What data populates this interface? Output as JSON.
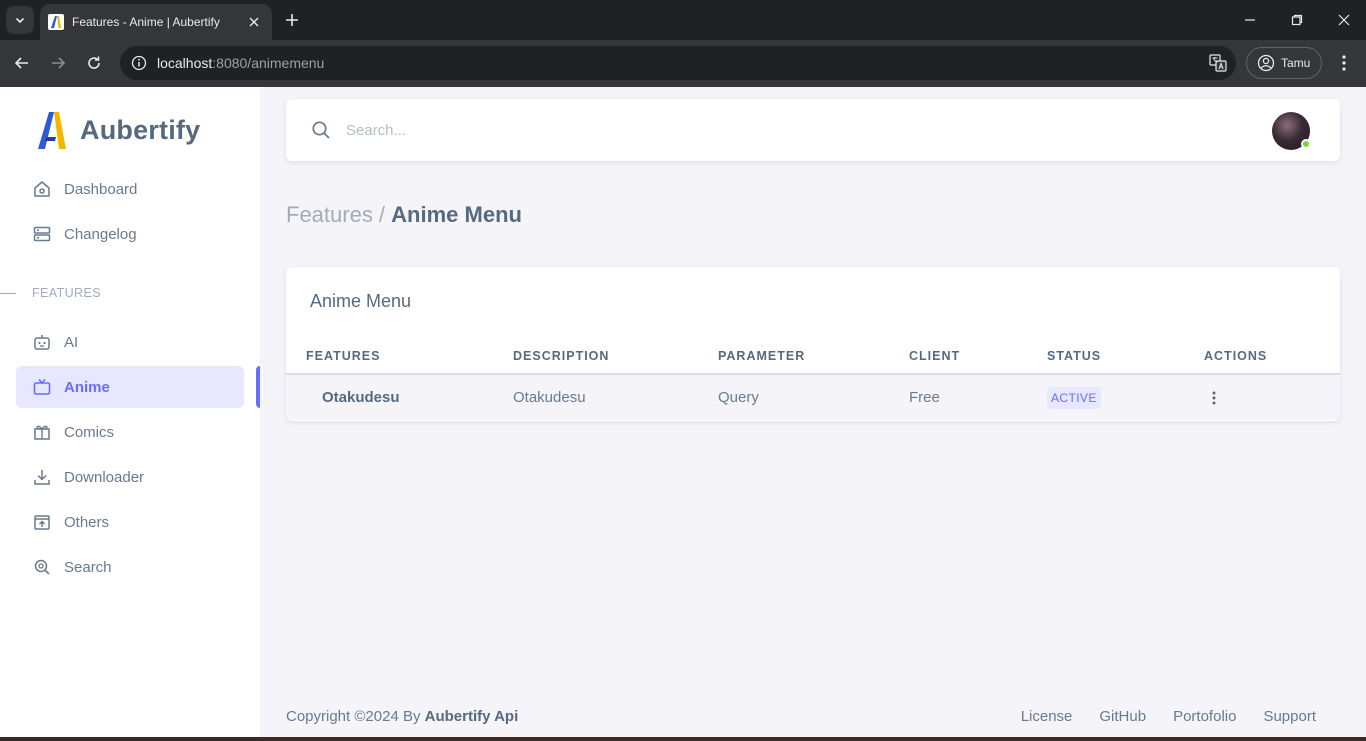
{
  "browser": {
    "tab_title": "Features - Anime | Aubertify",
    "url_host": "localhost",
    "url_path": ":8080/animemenu",
    "profile_name": "Tamu"
  },
  "sidebar": {
    "brand": "Aubertify",
    "items_top": [
      {
        "label": "Dashboard",
        "icon": "home-icon"
      },
      {
        "label": "Changelog",
        "icon": "server-icon"
      }
    ],
    "section_header": "FEATURES",
    "items_features": [
      {
        "label": "AI",
        "icon": "bot-icon"
      },
      {
        "label": "Anime",
        "icon": "tv-icon",
        "active": true
      },
      {
        "label": "Comics",
        "icon": "book-icon"
      },
      {
        "label": "Downloader",
        "icon": "download-icon"
      },
      {
        "label": "Others",
        "icon": "upload-box-icon"
      },
      {
        "label": "Search",
        "icon": "search-zoom-icon"
      }
    ]
  },
  "search": {
    "placeholder": "Search..."
  },
  "breadcrumb": {
    "parent": "Features /",
    "current": "Anime Menu"
  },
  "card": {
    "title": "Anime Menu",
    "columns": [
      "FEATURES",
      "DESCRIPTION",
      "PARAMETER",
      "CLIENT",
      "STATUS",
      "ACTIONS"
    ],
    "rows": [
      {
        "feature": "Otakudesu",
        "description": "Otakudesu",
        "parameter": "Query",
        "client": "Free",
        "status": "ACTIVE"
      }
    ]
  },
  "footer": {
    "copyright": "Copyright ©2024 By",
    "brand": "Aubertify Api",
    "links": [
      "License",
      "GitHub",
      "Portofolio",
      "Support"
    ]
  },
  "colors": {
    "accent": "#696cff",
    "text": "#697a8d",
    "heading": "#566a7f"
  }
}
